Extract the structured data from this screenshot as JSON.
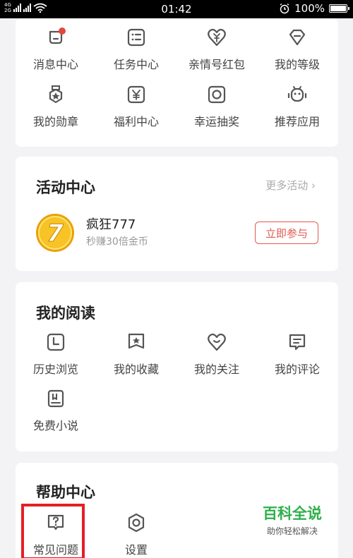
{
  "status_bar": {
    "network_top": "4G",
    "network_bottom": "2G",
    "time": "01:42",
    "battery_level_percent": 100,
    "battery_label": "100%"
  },
  "quick_grid": {
    "items": [
      {
        "label": "消息中心",
        "icon": "message-bell-icon",
        "badge": true
      },
      {
        "label": "任务中心",
        "icon": "task-list-icon"
      },
      {
        "label": "亲情号红包",
        "icon": "heart-red-packet-icon"
      },
      {
        "label": "我的等级",
        "icon": "level-gem-icon"
      },
      {
        "label": "我的勋章",
        "icon": "medal-icon"
      },
      {
        "label": "福利中心",
        "icon": "welfare-yen-icon"
      },
      {
        "label": "幸运抽奖",
        "icon": "lottery-icon"
      },
      {
        "label": "推荐应用",
        "icon": "robot-app-icon"
      }
    ]
  },
  "activity": {
    "title": "活动中心",
    "more": "更多活动 ›",
    "promo": {
      "coin_text": "7",
      "title": "疯狂777",
      "subtitle": "秒赚30倍金币",
      "button": "立即参与"
    }
  },
  "reading": {
    "title": "我的阅读",
    "items": [
      {
        "label": "历史浏览",
        "icon": "history-clock-icon"
      },
      {
        "label": "我的收藏",
        "icon": "bookmark-star-icon"
      },
      {
        "label": "我的关注",
        "icon": "heart-follow-icon"
      },
      {
        "label": "我的评论",
        "icon": "comment-icon"
      },
      {
        "label": "免费小说",
        "icon": "book-icon"
      }
    ]
  },
  "help": {
    "title": "帮助中心",
    "items": [
      {
        "label": "常见问题",
        "icon": "question-icon"
      },
      {
        "label": "设置",
        "icon": "settings-icon"
      }
    ]
  },
  "watermark": {
    "brand": "百科全说",
    "slogan": "助你轻松解决"
  },
  "colors": {
    "accent_red": "#e05a50",
    "highlight_red": "#e41f24",
    "watermark_green": "#2db04b",
    "icon_gray": "#555555",
    "coin_gold": "#f4b400"
  }
}
